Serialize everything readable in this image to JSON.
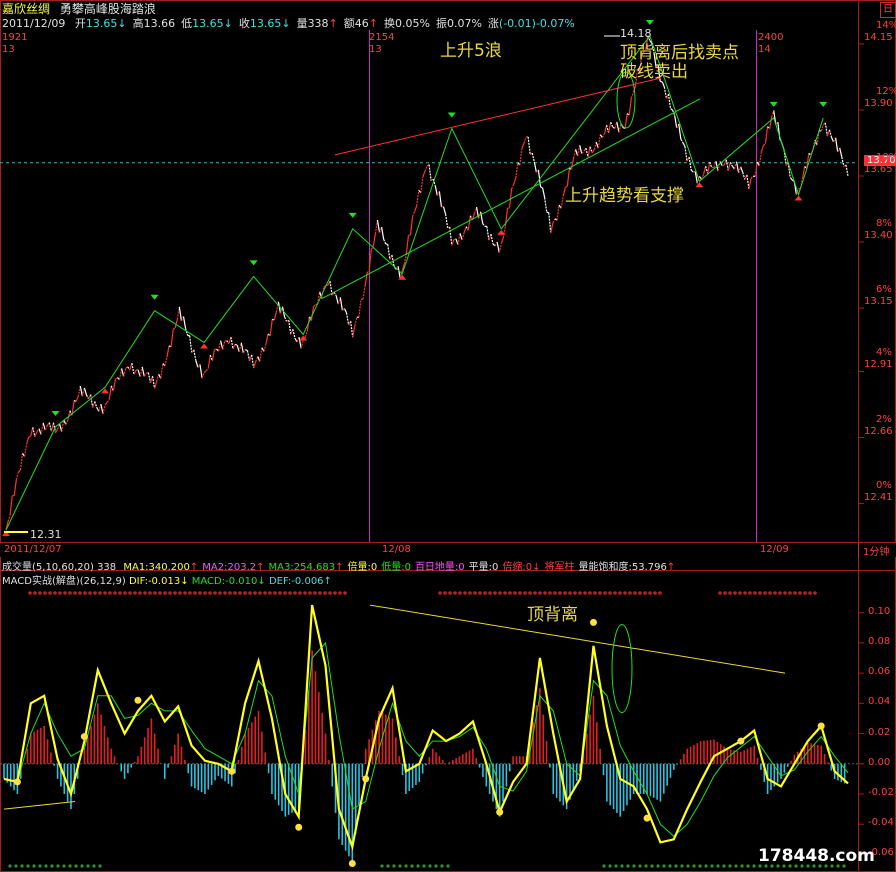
{
  "header": {
    "stock_name": "嘉欣丝绸",
    "strategy_name": "勇攀高峰股海踏浪",
    "date": "2011/12/09",
    "quote": [
      {
        "label": "开",
        "value": "13.65",
        "arrow": "↓"
      },
      {
        "label": "高",
        "value": "13.66",
        "arrow": ""
      },
      {
        "label": "低",
        "value": "13.65",
        "arrow": "↓"
      },
      {
        "label": "收",
        "value": "13.65",
        "arrow": "↓"
      },
      {
        "label": "量",
        "value": "338",
        "arrow": "↑"
      },
      {
        "label": "额",
        "value": "46",
        "arrow": "↑"
      },
      {
        "label": "换",
        "value": "0.05%",
        "arrow": ""
      },
      {
        "label": "振",
        "value": "0.07%",
        "arrow": ""
      },
      {
        "label": "涨",
        "value": "(-0.01)-0.07%",
        "arrow": ""
      }
    ],
    "corner_label": "日"
  },
  "price_panel": {
    "marks": [
      {
        "top": "1921",
        "bottom": "13"
      },
      {
        "top": "2154",
        "bottom": "13"
      },
      {
        "top": "2400",
        "bottom": "14"
      }
    ],
    "low_label": "12.31",
    "high_label": "14.18",
    "current_price": "13.70",
    "y_ticks": [
      {
        "price": "14.15",
        "pct": "14%"
      },
      {
        "price": "13.90",
        "pct": "12%"
      },
      {
        "price": "13.65",
        "pct": "10%"
      },
      {
        "price": "13.40",
        "pct": "8%"
      },
      {
        "price": "13.15",
        "pct": "6%"
      },
      {
        "price": "12.91",
        "pct": "4%"
      },
      {
        "price": "12.66",
        "pct": "2%"
      },
      {
        "price": "12.41",
        "pct": "0%"
      }
    ],
    "annotations": [
      "上升5浪",
      "顶背离后找卖点",
      "破线卖出",
      "上升趋势看支撑"
    ]
  },
  "date_axis": {
    "labels": [
      "2011/12/07",
      "12/08",
      "12/09"
    ],
    "period": "1分钟"
  },
  "volume_bar": {
    "title": "成交量",
    "params": "(5,10,60,20)",
    "value": "338",
    "items": [
      {
        "text": "MA1:340.200",
        "arrow": "↑"
      },
      {
        "text": "MA2:203.2",
        "arrow": "↑"
      },
      {
        "text": "MA3:254.683",
        "arrow": "↑"
      },
      {
        "text": "倍量:0",
        "arrow": ""
      },
      {
        "text": "低量:0",
        "arrow": ""
      },
      {
        "text": "百日地量:0",
        "arrow": ""
      },
      {
        "text": "平量:0",
        "arrow": ""
      },
      {
        "text": "倍缩:0",
        "arrow": "↓"
      },
      {
        "text": "将军柱",
        "arrow": ""
      },
      {
        "text": "量能饱和度:53.796",
        "arrow": "↑"
      }
    ]
  },
  "macd_panel": {
    "title": "MACD实战(解盘)",
    "params": "(26,12,9)",
    "dif": "DIF:-0.013",
    "dif_arrow": "↓",
    "macd": "MACD:-0.010",
    "macd_arrow": "↓",
    "def": "DEF:-0.006",
    "def_arrow": "↑",
    "y_ticks": [
      "0.10",
      "0.08",
      "0.06",
      "0.04",
      "0.02",
      "0.00",
      "-0.02",
      "-0.04",
      "-0.06"
    ],
    "annotation": "顶背离"
  },
  "watermark": "178448.com",
  "colors": {
    "background": "#000000",
    "up": "#ff3030",
    "down": "#ffffff",
    "wave": "#20e020",
    "resistance": "#ff3030",
    "support": "#20e020",
    "macd_pos": "#e02020",
    "macd_neg": "#30c0e0",
    "dif": "#ffff20",
    "dea": "#20e020",
    "divider": "#c030c0",
    "annotation": "#e8d840"
  },
  "chart_data": [
    {
      "type": "line",
      "title": "嘉欣丝绸 1分钟",
      "xlabel": "",
      "ylabel": "",
      "ylim": [
        12.31,
        14.18
      ],
      "x": [
        "2011/12/07",
        "12/08",
        "12/09"
      ],
      "series": [
        {
          "name": "",
          "values": [
            12.31,
            12.7,
            12.68,
            12.82,
            12.78,
            12.95,
            12.85,
            13.12,
            12.9,
            13.05,
            12.93,
            13.14,
            13.02,
            13.27,
            13.05,
            13.45,
            13.28,
            13.72,
            13.4,
            13.5,
            13.38,
            13.83,
            13.45,
            13.72,
            13.79,
            13.86,
            14.18,
            13.85,
            13.63,
            13.72,
            13.62,
            13.87,
            13.58,
            13.87,
            13.65
          ]
        }
      ],
      "wave_points": [
        {
          "price": 12.31,
          "kind": "low"
        },
        {
          "price": 12.7,
          "kind": "high"
        },
        {
          "price": 12.85,
          "kind": "low"
        },
        {
          "price": 13.14,
          "kind": "high"
        },
        {
          "price": 13.02,
          "kind": "low"
        },
        {
          "price": 13.27,
          "kind": "high"
        },
        {
          "price": 13.05,
          "kind": "low"
        },
        {
          "price": 13.45,
          "kind": "high"
        },
        {
          "price": 13.28,
          "kind": "low"
        },
        {
          "price": 13.83,
          "kind": "high"
        },
        {
          "price": 13.45,
          "kind": "low"
        },
        {
          "price": 14.18,
          "kind": "high"
        },
        {
          "price": 13.63,
          "kind": "low"
        },
        {
          "price": 13.87,
          "kind": "high"
        },
        {
          "price": 13.58,
          "kind": "low"
        },
        {
          "price": 13.87,
          "kind": "high"
        }
      ]
    },
    {
      "type": "bar",
      "title": "MACD实战(解盘)",
      "xlabel": "",
      "ylabel": "",
      "ylim": [
        -0.065,
        0.115
      ],
      "series": [
        {
          "name": "DIF",
          "values": [
            -0.01,
            -0.012,
            0.04,
            0.045,
            0.003,
            -0.02,
            0.015,
            0.062,
            0.04,
            0.02,
            0.035,
            0.045,
            0.028,
            0.038,
            0.012,
            0.002,
            0.0,
            -0.005,
            0.04,
            0.068,
            0.03,
            -0.02,
            -0.035,
            0.105,
            0.065,
            -0.03,
            -0.055,
            -0.01,
            0.03,
            0.05,
            -0.005,
            0.0,
            0.022,
            0.015,
            0.02,
            0.028,
            0.0,
            -0.032,
            -0.012,
            0.0,
            0.07,
            0.02,
            -0.025,
            -0.01,
            0.078,
            0.025,
            -0.01,
            -0.015,
            -0.03,
            -0.052,
            -0.05,
            -0.03,
            -0.012,
            0.005,
            0.01,
            0.015,
            0.022,
            -0.01,
            -0.015,
            0.0,
            0.015,
            0.025,
            -0.005,
            -0.013
          ]
        },
        {
          "name": "DEA",
          "values": [
            -0.01,
            -0.012,
            0.02,
            0.04,
            0.02,
            0.005,
            0.01,
            0.045,
            0.045,
            0.03,
            0.032,
            0.04,
            0.035,
            0.035,
            0.022,
            0.01,
            0.005,
            0.0,
            0.02,
            0.055,
            0.045,
            0.005,
            -0.02,
            0.07,
            0.08,
            0.02,
            -0.03,
            -0.025,
            0.01,
            0.04,
            0.015,
            0.005,
            0.015,
            0.015,
            0.018,
            0.024,
            0.01,
            -0.015,
            -0.018,
            -0.005,
            0.045,
            0.035,
            0.0,
            -0.008,
            0.055,
            0.045,
            0.012,
            -0.005,
            -0.02,
            -0.04,
            -0.048,
            -0.04,
            -0.025,
            -0.008,
            0.004,
            0.011,
            0.018,
            0.005,
            -0.008,
            -0.004,
            0.008,
            0.018,
            0.005,
            -0.006
          ]
        },
        {
          "name": "MACD",
          "values": [
            -0.01,
            -0.02,
            0.02,
            0.025,
            -0.01,
            -0.03,
            0.01,
            0.04,
            0.01,
            -0.01,
            0.005,
            0.03,
            -0.01,
            0.02,
            -0.015,
            -0.02,
            -0.008,
            -0.015,
            0.02,
            0.035,
            -0.02,
            -0.035,
            -0.03,
            0.075,
            0.02,
            -0.05,
            -0.065,
            0.01,
            0.035,
            0.03,
            -0.02,
            -0.012,
            0.01,
            0.0,
            0.005,
            0.01,
            -0.015,
            -0.035,
            0.005,
            0.005,
            0.05,
            -0.02,
            -0.03,
            -0.005,
            0.045,
            -0.025,
            -0.035,
            -0.02,
            -0.02,
            -0.025,
            -0.004,
            0.01,
            0.015,
            0.016,
            0.01,
            0.008,
            0.012,
            -0.02,
            -0.01,
            0.006,
            0.014,
            0.012,
            -0.01,
            -0.014
          ]
        }
      ]
    }
  ]
}
